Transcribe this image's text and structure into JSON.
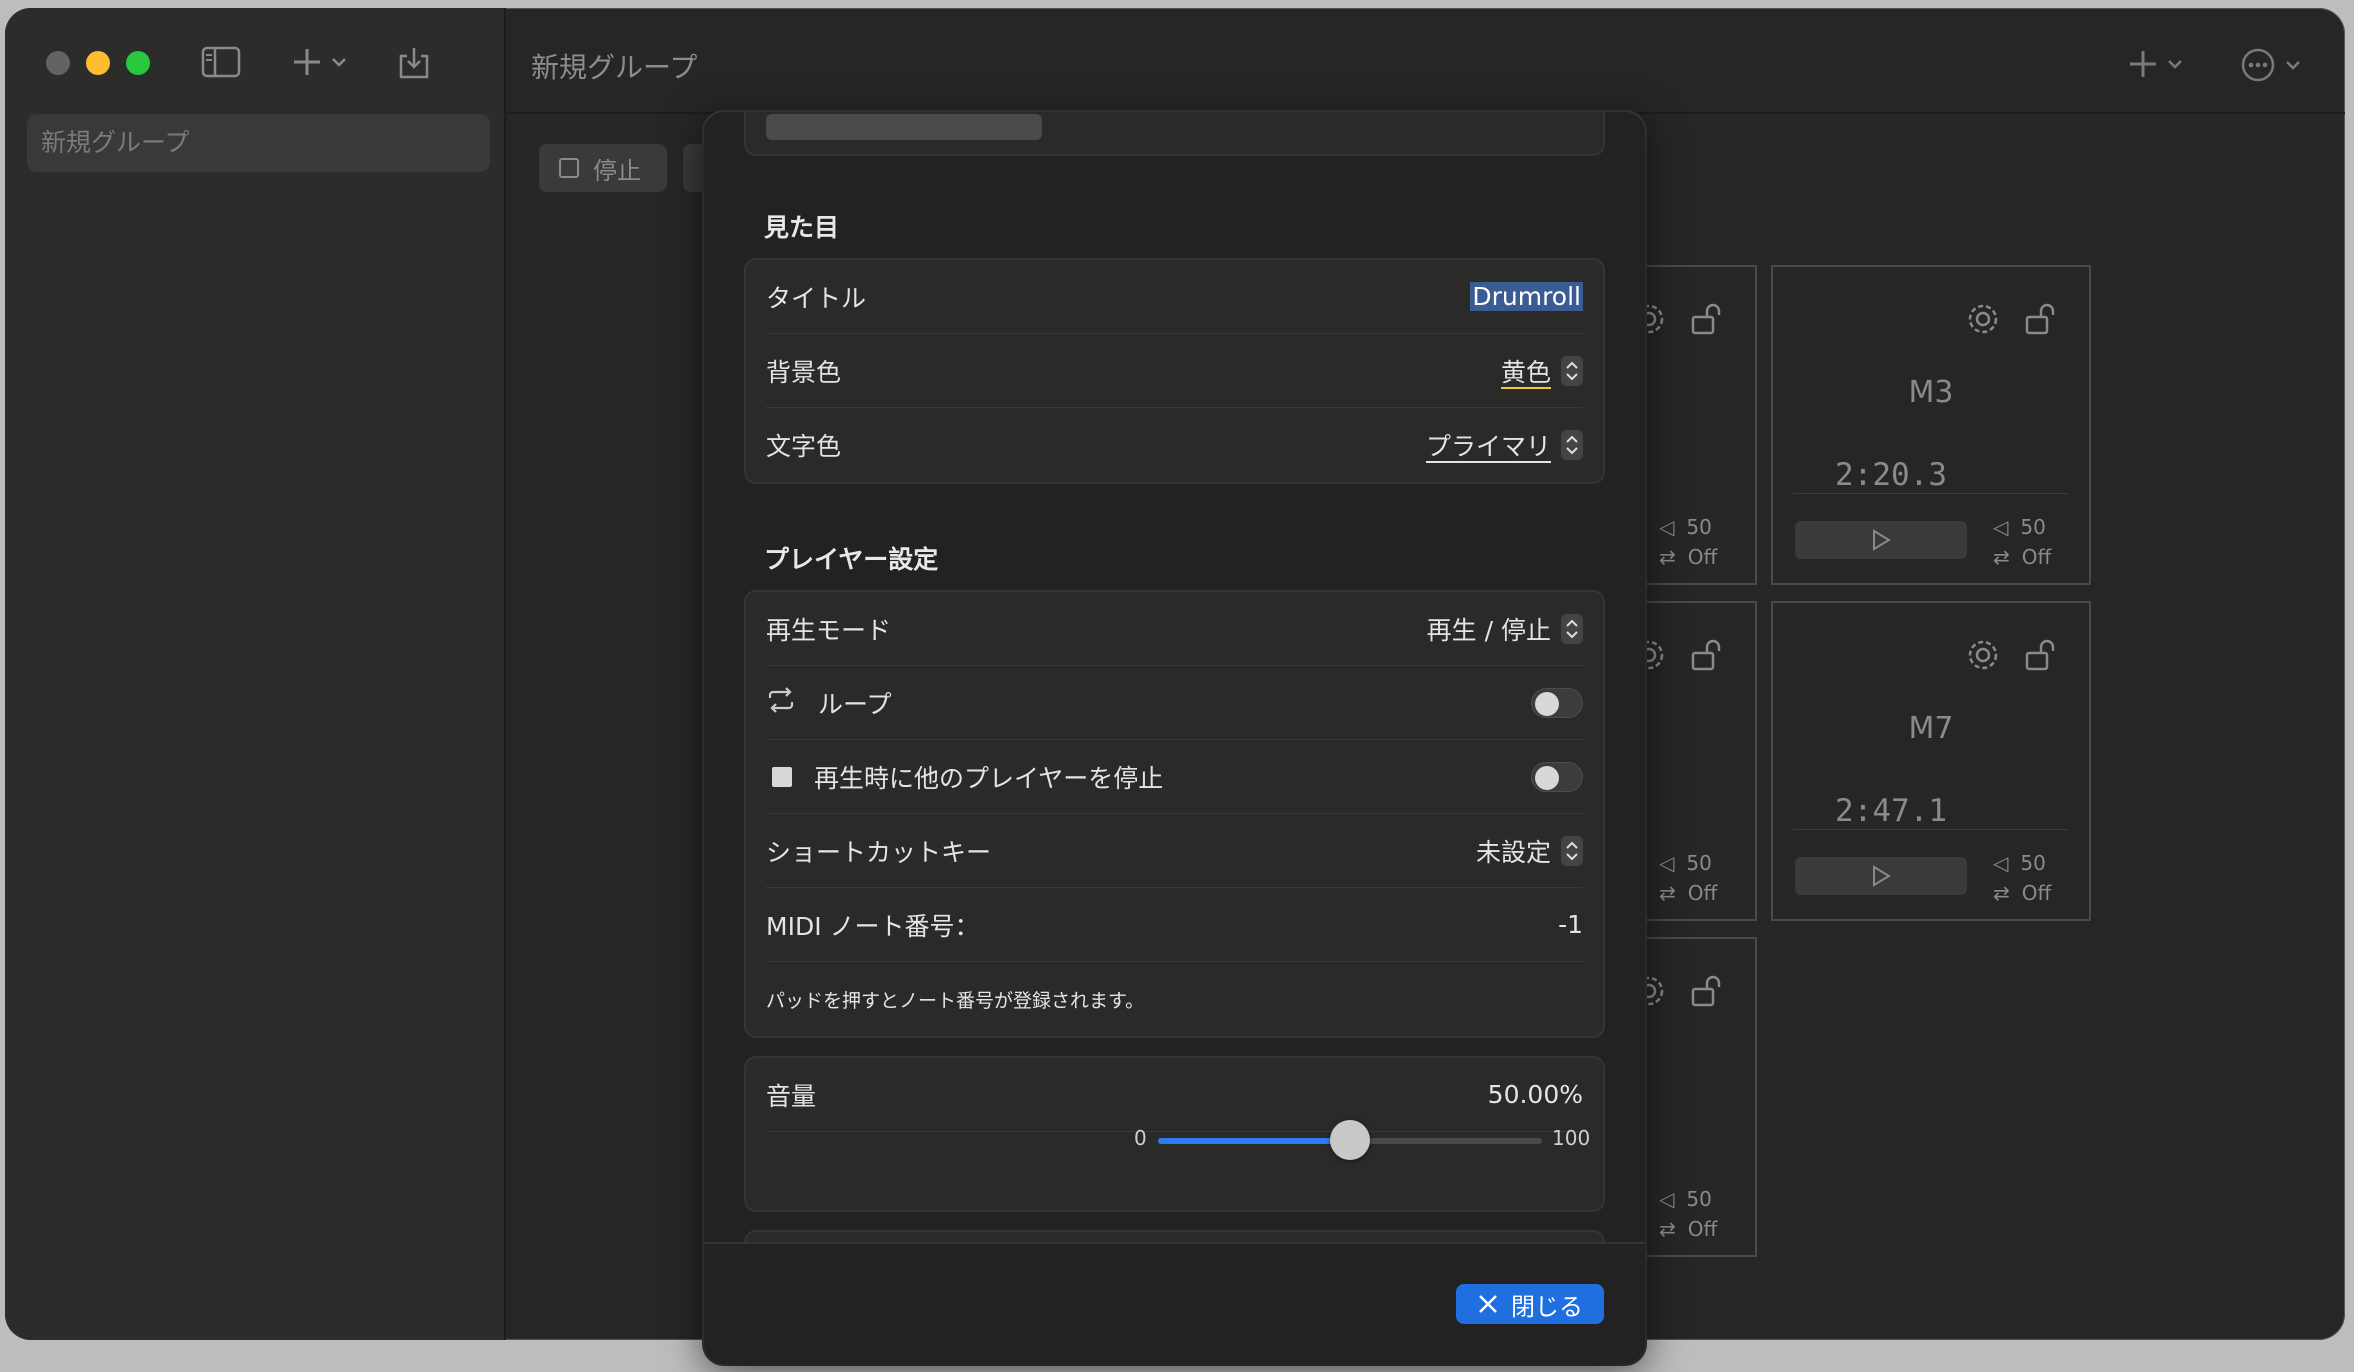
{
  "sidebar": {
    "group_name": "新規グループ"
  },
  "main": {
    "title": "新規グループ",
    "stop_label": "停止",
    "pads": [
      {
        "name": "M3",
        "time": "2:20.3",
        "volume": "50",
        "loop": "Off"
      },
      {
        "name": "M7",
        "time": "2:47.1",
        "volume": "50",
        "loop": "Off"
      },
      {
        "name": "",
        "time": "",
        "volume": "50",
        "loop": "Off"
      },
      {
        "name": "",
        "time": "",
        "volume": "50",
        "loop": "Off"
      },
      {
        "name": "",
        "time": "",
        "volume": "50",
        "loop": "Off"
      }
    ]
  },
  "modal": {
    "appearance": {
      "section_title": "見た目",
      "title_label": "タイトル",
      "title_value": "Drumroll",
      "bg_label": "背景色",
      "bg_value": "黄色",
      "text_label": "文字色",
      "text_value": "プライマリ"
    },
    "player": {
      "section_title": "プレイヤー設定",
      "mode_label": "再生モード",
      "mode_value": "再生 / 停止",
      "loop_label": "ループ",
      "loop_on": false,
      "stop_others_label": "再生時に他のプレイヤーを停止",
      "stop_others_on": false,
      "shortcut_label": "ショートカットキー",
      "shortcut_value": "未設定",
      "midi_label": "MIDI ノート番号：",
      "midi_value": "-1",
      "midi_hint": "パッドを押すとノート番号が登録されます。"
    },
    "volume": {
      "label": "音量",
      "value_text": "50.00%",
      "min": "0",
      "max": "100",
      "value": 50
    },
    "close_label": "閉じる"
  },
  "colors": {
    "accent": "#1f6fe0",
    "bg_yellow": "#f5c542"
  }
}
